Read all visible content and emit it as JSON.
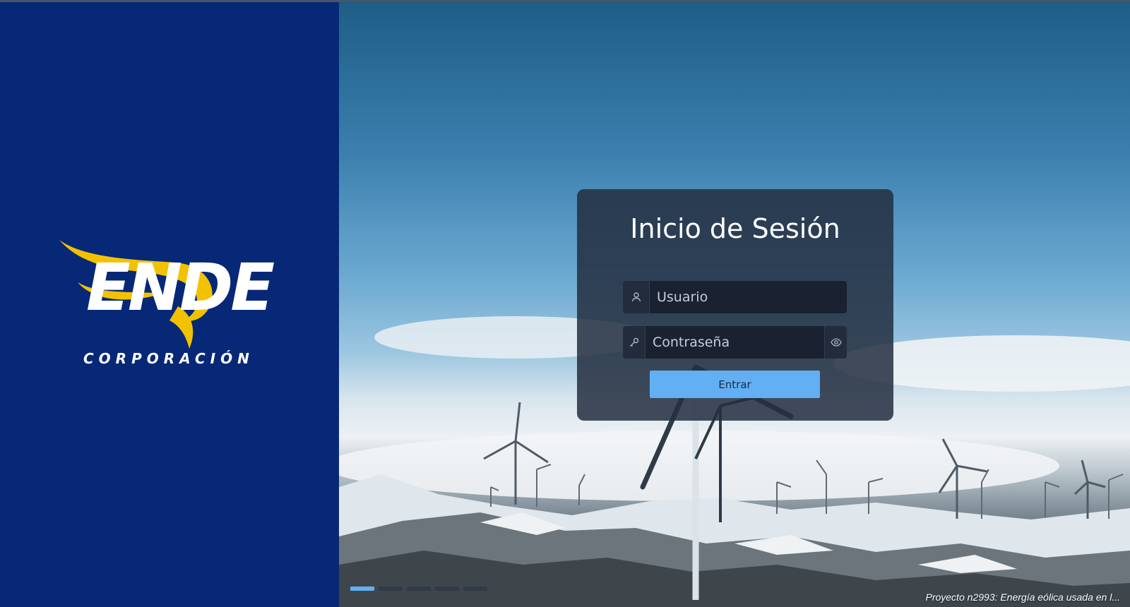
{
  "brand": {
    "logo_text": "ENDE",
    "logo_subtitle": "CORPORACIÓN",
    "logo_icon": "ende-bird-logo",
    "colors": {
      "panel": "#072877",
      "accent": "#f2c200"
    }
  },
  "login": {
    "title": "Inicio de Sesión",
    "username": {
      "placeholder": "Usuario",
      "value": "",
      "icon": "user-icon"
    },
    "password": {
      "placeholder": "Contraseña",
      "value": "",
      "icon": "key-icon",
      "toggle_icon": "eye-icon"
    },
    "submit_label": "Entrar",
    "colors": {
      "button": "#62b0f3"
    }
  },
  "background": {
    "caption": "Proyecto n2993: Energía eólica usada en l...",
    "slides": 5,
    "active_slide": 1
  }
}
